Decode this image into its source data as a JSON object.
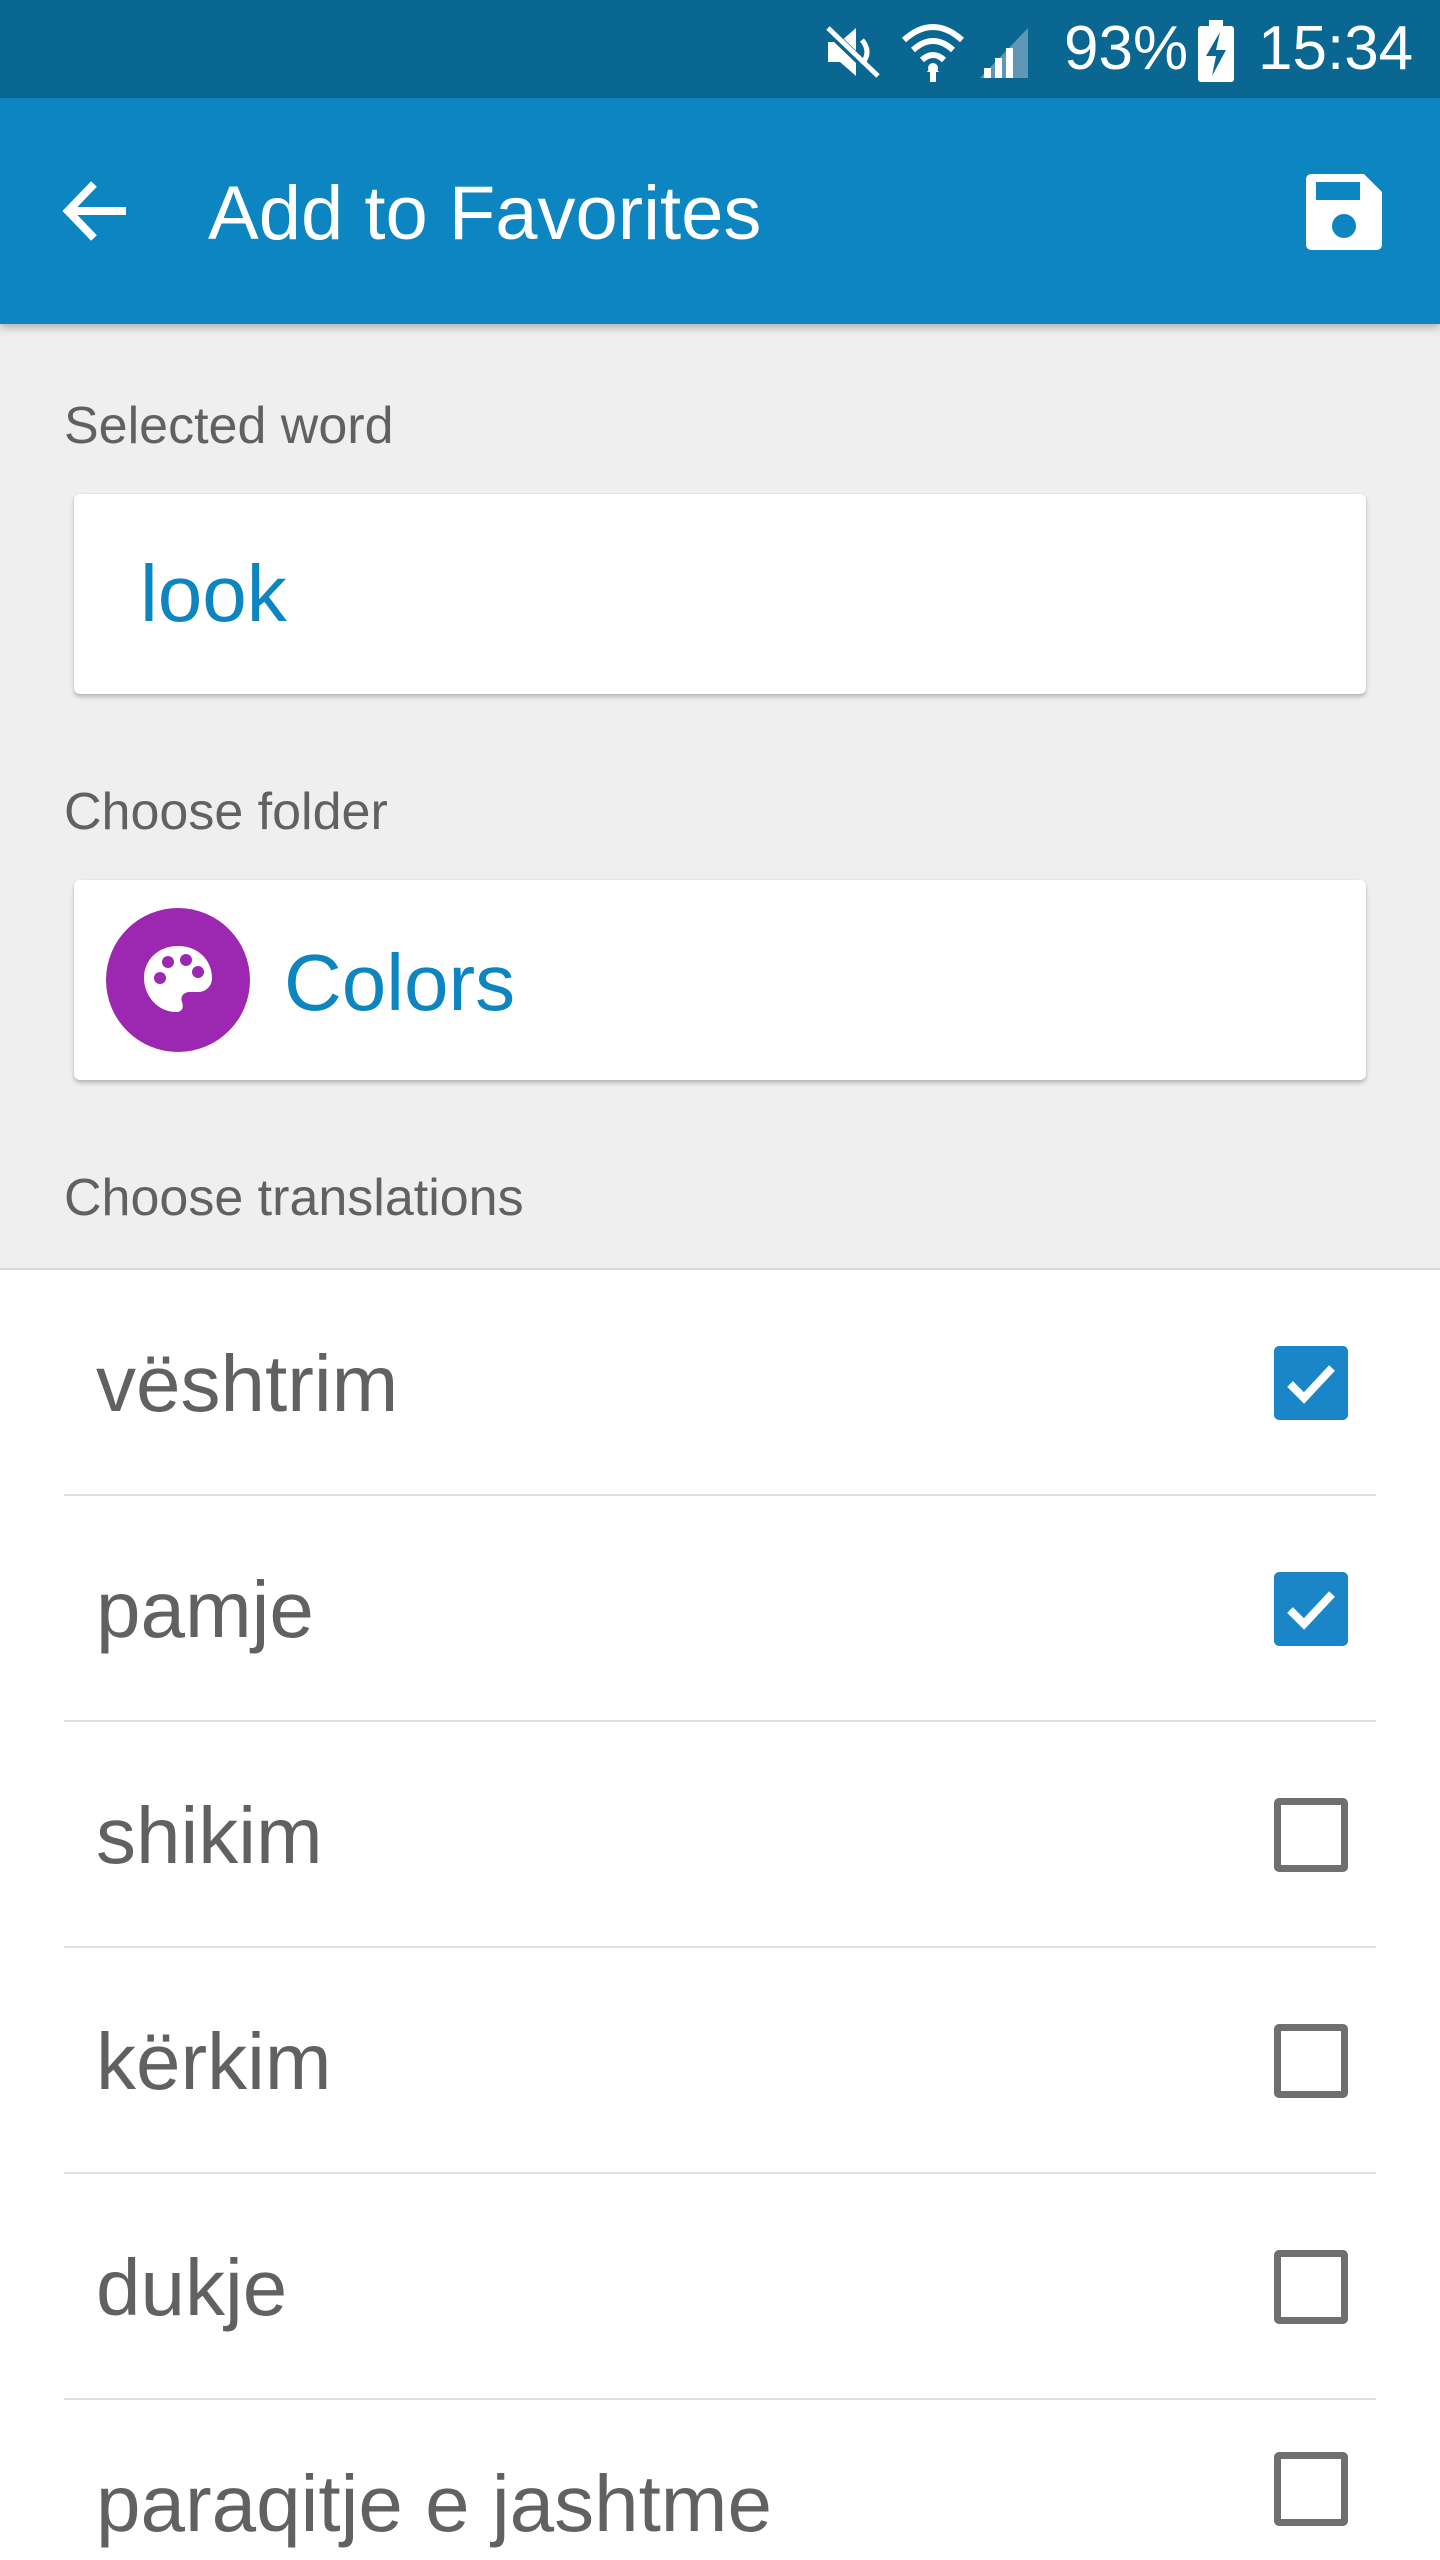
{
  "status_bar": {
    "battery": "93%",
    "time": "15:34",
    "icons": [
      "mute-icon",
      "wifi-icon",
      "signal-icon",
      "battery-charging-icon"
    ]
  },
  "app_bar": {
    "title": "Add to Favorites",
    "back_icon": "arrow-back-icon",
    "save_icon": "save-icon",
    "color": "#0c85c1"
  },
  "form": {
    "selected_word_label": "Selected word",
    "selected_word_value": "look",
    "folder_label": "Choose folder",
    "folder_name": "Colors",
    "folder_icon": "palette-icon",
    "folder_icon_color": "#9c27b0",
    "translations_label": "Choose translations"
  },
  "translations": [
    {
      "label": "vështrim",
      "checked": true
    },
    {
      "label": "pamje",
      "checked": true
    },
    {
      "label": "shikim",
      "checked": false
    },
    {
      "label": "kërkim",
      "checked": false
    },
    {
      "label": "dukje",
      "checked": false
    },
    {
      "label": "paraqitje e jashtme",
      "checked": false
    }
  ],
  "colors": {
    "accent": "#0c85c1",
    "status_bar": "#0a6791",
    "checkbox_checked": "#1a86c7"
  }
}
